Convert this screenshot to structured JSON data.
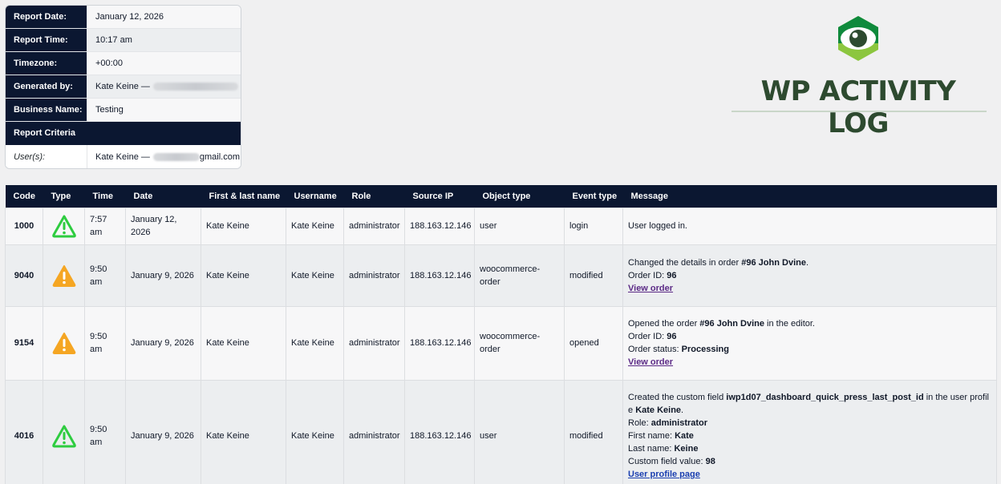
{
  "report": {
    "rows": [
      {
        "label": "Report Date:",
        "value": "January 12, 2026"
      },
      {
        "label": "Report Time:",
        "value": "10:17 am"
      },
      {
        "label": "Timezone:",
        "value": "+00:00"
      },
      {
        "label": "Generated by:",
        "value": "Kate Keine —"
      },
      {
        "label": "Business Name:",
        "value": "Testing"
      }
    ],
    "criteria_title": "Report Criteria",
    "criteria": {
      "label": "User(s):",
      "value": "Kate Keine —",
      "suffix": "gmail.com"
    }
  },
  "logo": {
    "text": "WP ACTIVITY LOG"
  },
  "table": {
    "headers": [
      "Code",
      "Type",
      "Time",
      "Date",
      "First & last name",
      "Username",
      "Role",
      "Source IP",
      "Object type",
      "Event type",
      "Message"
    ],
    "rows": [
      {
        "code": "1000",
        "type_icon": "warning-triangle-icon-green",
        "time": "7:57 am",
        "date": "January 12, 2026",
        "name": "Kate Keine",
        "username": "Kate Keine",
        "role": "administrator",
        "ip": "188.163.12.146",
        "object": "user",
        "event": "login",
        "message": {
          "line1": "User logged in."
        }
      },
      {
        "code": "9040",
        "type_icon": "warning-triangle-icon-orange",
        "time": "9:50 am",
        "date": "January 9, 2026",
        "name": "Kate Keine",
        "username": "Kate Keine",
        "role": "administrator",
        "ip": "188.163.12.146",
        "object": "woocommerce-order",
        "event": "modified",
        "message": {
          "line1_pre": "Changed the details in order ",
          "line1_bold": "#96 John Dvine",
          "line1_post": ".",
          "order_label": "Order ID: ",
          "order_value": "96",
          "link": "View order"
        }
      },
      {
        "code": "9154",
        "type_icon": "warning-triangle-icon-orange",
        "time": "9:50 am",
        "date": "January 9, 2026",
        "name": "Kate Keine",
        "username": "Kate Keine",
        "role": "administrator",
        "ip": "188.163.12.146",
        "object": "woocommerce-order",
        "event": "opened",
        "message": {
          "line1_pre": "Opened the order ",
          "line1_bold": "#96 John Dvine",
          "line1_post": " in the editor.",
          "order_label": "Order ID: ",
          "order_value": "96",
          "status_label": "Order status: ",
          "status_value": "Processing",
          "link": "View order"
        }
      },
      {
        "code": "4016",
        "type_icon": "warning-triangle-icon-green",
        "time": "9:50 am",
        "date": "January 9, 2026",
        "name": "Kate Keine",
        "username": "Kate Keine",
        "role": "administrator",
        "ip": "188.163.12.146",
        "object": "user",
        "event": "modified",
        "message": {
          "line1_pre": "Created the custom field ",
          "line1_bold": "iwp1d07_dashboard_quick_press_last_post_id",
          "line1_mid": " in the user profile ",
          "line1_bold2": "Kate Keine",
          "line1_post": ".",
          "role_label": "Role: ",
          "role_value": "administrator",
          "first_label": "First name: ",
          "first_value": "Kate",
          "last_label": "Last name: ",
          "last_value": "Keine",
          "custom_label": "Custom field value: ",
          "custom_value": "98",
          "link": "User profile page"
        }
      }
    ]
  },
  "colors": {
    "header_bg": "#0b1731",
    "icon_green": "#2ecc40",
    "icon_orange": "#f5a623",
    "logo_green": "#2d4a2f",
    "logo_lime": "#8cc63f"
  }
}
